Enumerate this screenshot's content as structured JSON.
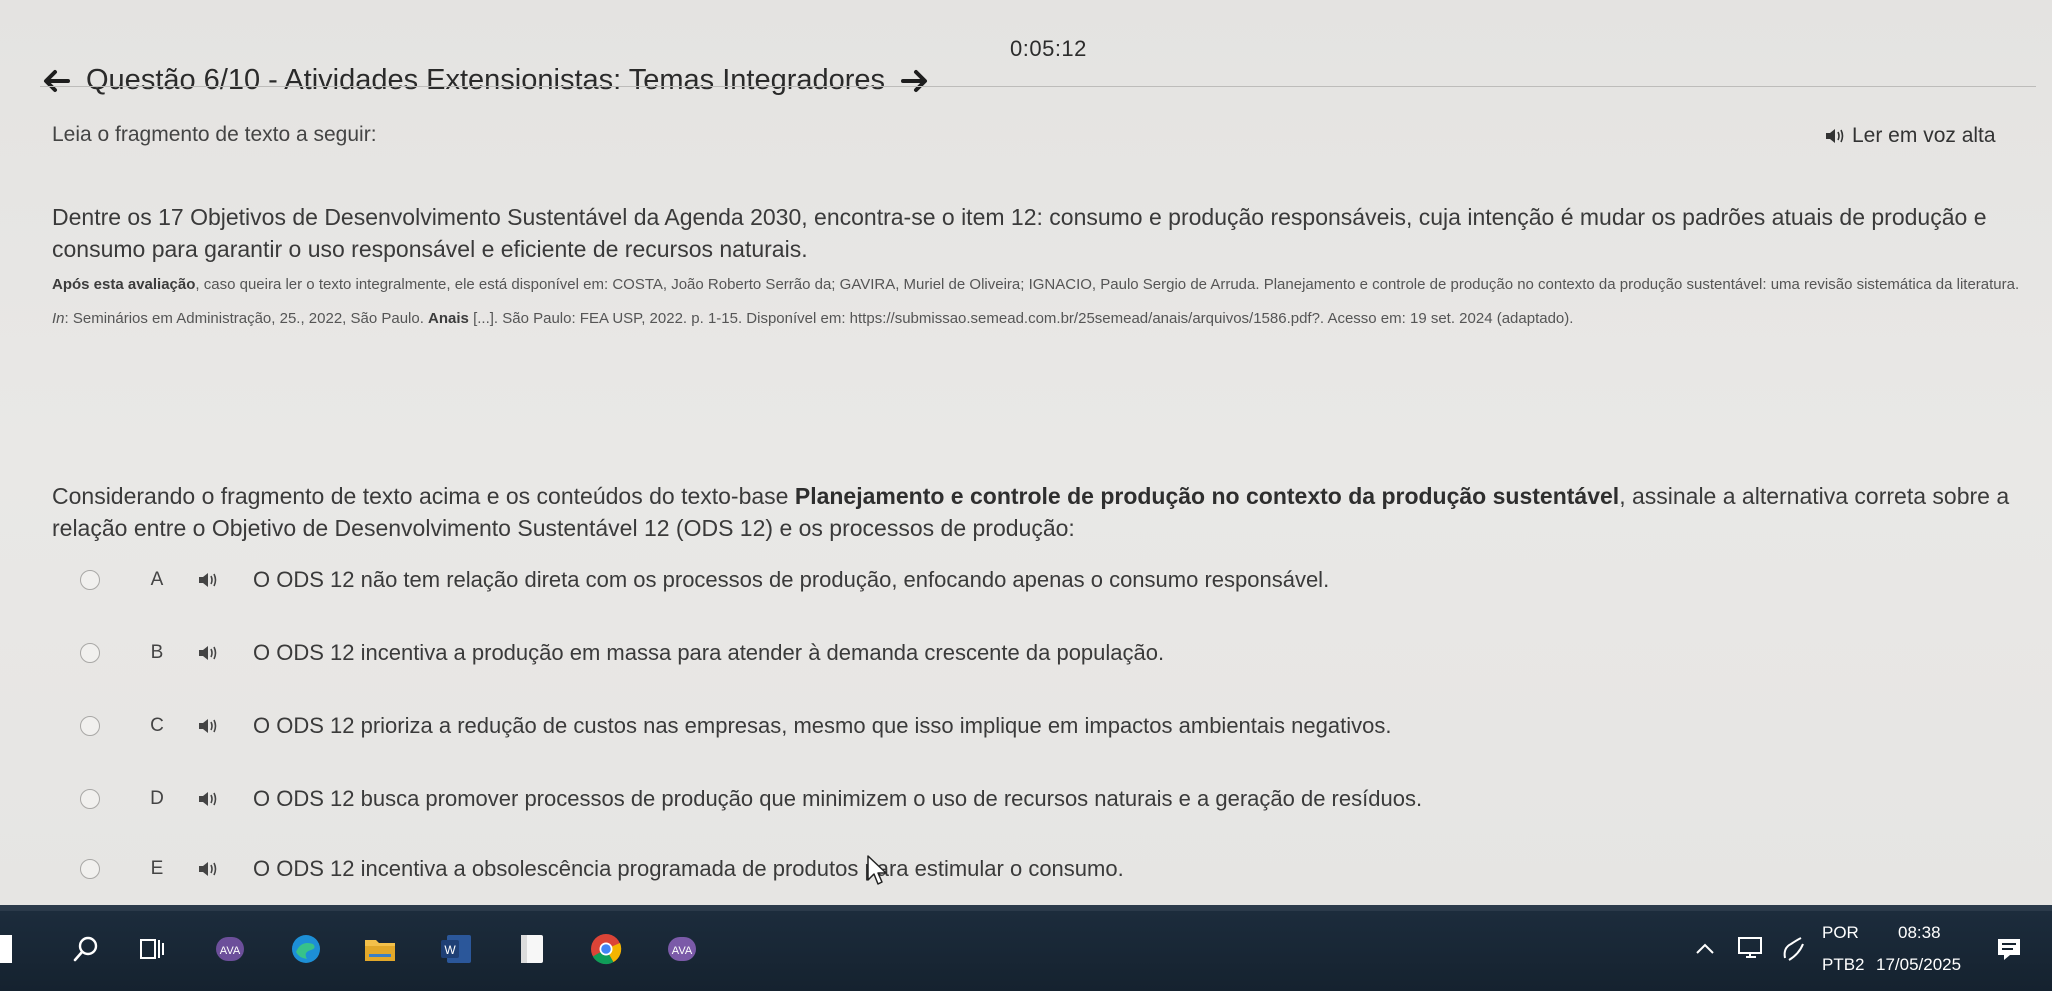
{
  "header": {
    "timer": "0:05:12",
    "title": "Questão 6/10 - Atividades Extensionistas: Temas Integradores"
  },
  "content": {
    "prompt": "Leia o fragmento de texto a seguir:",
    "read_aloud_label": "Ler em voz alta",
    "paragraph": "Dentre os 17 Objetivos de Desenvolvimento Sustentável da Agenda 2030, encontra-se o item 12: consumo e produção responsáveis, cuja intenção é mudar os padrões atuais de produção e consumo para garantir o uso responsável e eficiente de recursos naturais.",
    "citation": {
      "lead": "Após esta avaliação",
      "part1": ", caso queira ler o texto integralmente, ele está disponível em: COSTA, João Roberto Serrão da; GAVIRA, Muriel de Oliveira; IGNACIO, Paulo Sergio de Arruda. Planejamento e controle de produção no contexto da produção sustentável: uma revisão sistemática da literatura. ",
      "in": "In",
      "part2": ": Seminários em Administração, 25., 2022, São Paulo. ",
      "anais": "Anais",
      "part3": " [...]. São Paulo: FEA USP, 2022. p. 1-15. Disponível em: https://submissao.semead.com.br/25semead/anais/arquivos/1586.pdf?. Acesso em: 19 set. 2024 (adaptado)."
    },
    "question": {
      "part1": "Considerando o fragmento de texto acima e os conteúdos do texto-base ",
      "bold": "Planejamento e controle de produção no contexto da produção sustentável",
      "part2": ", assinale a alternativa correta sobre a relação entre o Objetivo de Desenvolvimento Sustentável 12 (ODS 12) e os processos de produção:"
    },
    "options": [
      {
        "letter": "A",
        "text": "O ODS 12 não tem relação direta com os processos de produção, enfocando apenas o consumo responsável."
      },
      {
        "letter": "B",
        "text": "O ODS 12 incentiva a produção em massa para atender à demanda crescente da população."
      },
      {
        "letter": "C",
        "text": "O ODS 12 prioriza a redução de custos nas empresas, mesmo que isso implique em impactos ambientais negativos."
      },
      {
        "letter": "D",
        "text": "O ODS 12 busca promover processos de produção que minimizem o uso de recursos naturais e a geração de resíduos."
      },
      {
        "letter": "E",
        "text": "O ODS 12 incentiva a obsolescência programada de produtos para estimular o consumo."
      }
    ]
  },
  "taskbar": {
    "apps": [
      "search-icon",
      "task-view-icon",
      "ava-app-icon",
      "edge-icon",
      "file-explorer-icon",
      "word-icon",
      "notes-icon",
      "chrome-icon",
      "ava-app-icon"
    ],
    "lang_top": "POR",
    "lang_bottom": "PTB2",
    "time": "08:38",
    "date": "17/05/2025"
  }
}
